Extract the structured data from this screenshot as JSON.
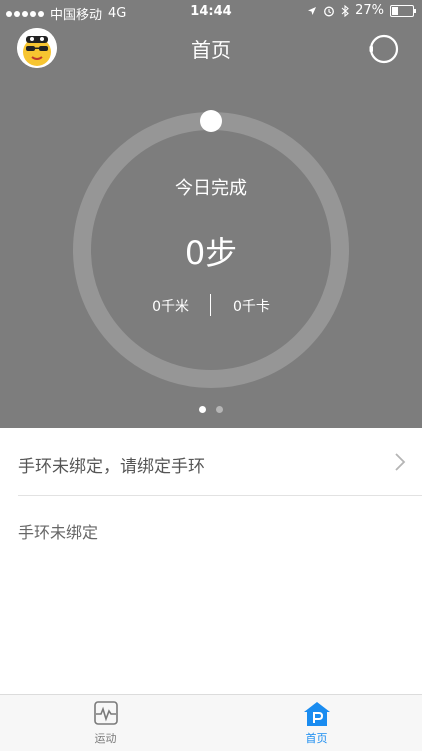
{
  "status_bar": {
    "carrier": "中国移动",
    "network": "4G",
    "time": "14:44",
    "battery": "27%"
  },
  "header": {
    "title": "首页",
    "avatar_icon": "avatar-emoji-icon",
    "watch_icon": "watch-icon"
  },
  "ring": {
    "title": "今日完成",
    "steps": "0步",
    "distance": "0千米",
    "calories": "0千卡",
    "progress": 0
  },
  "pager": {
    "count": 2,
    "active": 0
  },
  "content": {
    "bind_prompt": "手环未绑定，请绑定手环",
    "bind_status": "手环未绑定"
  },
  "tabs": [
    {
      "label": "运动",
      "icon": "activity-icon",
      "active": false
    },
    {
      "label": "首页",
      "icon": "home-p-icon",
      "active": true
    }
  ],
  "colors": {
    "hero_bg": "#7d7d7d",
    "ring": "#969696",
    "accent": "#1a8cf0",
    "tab_inactive": "#7a7a7a"
  }
}
